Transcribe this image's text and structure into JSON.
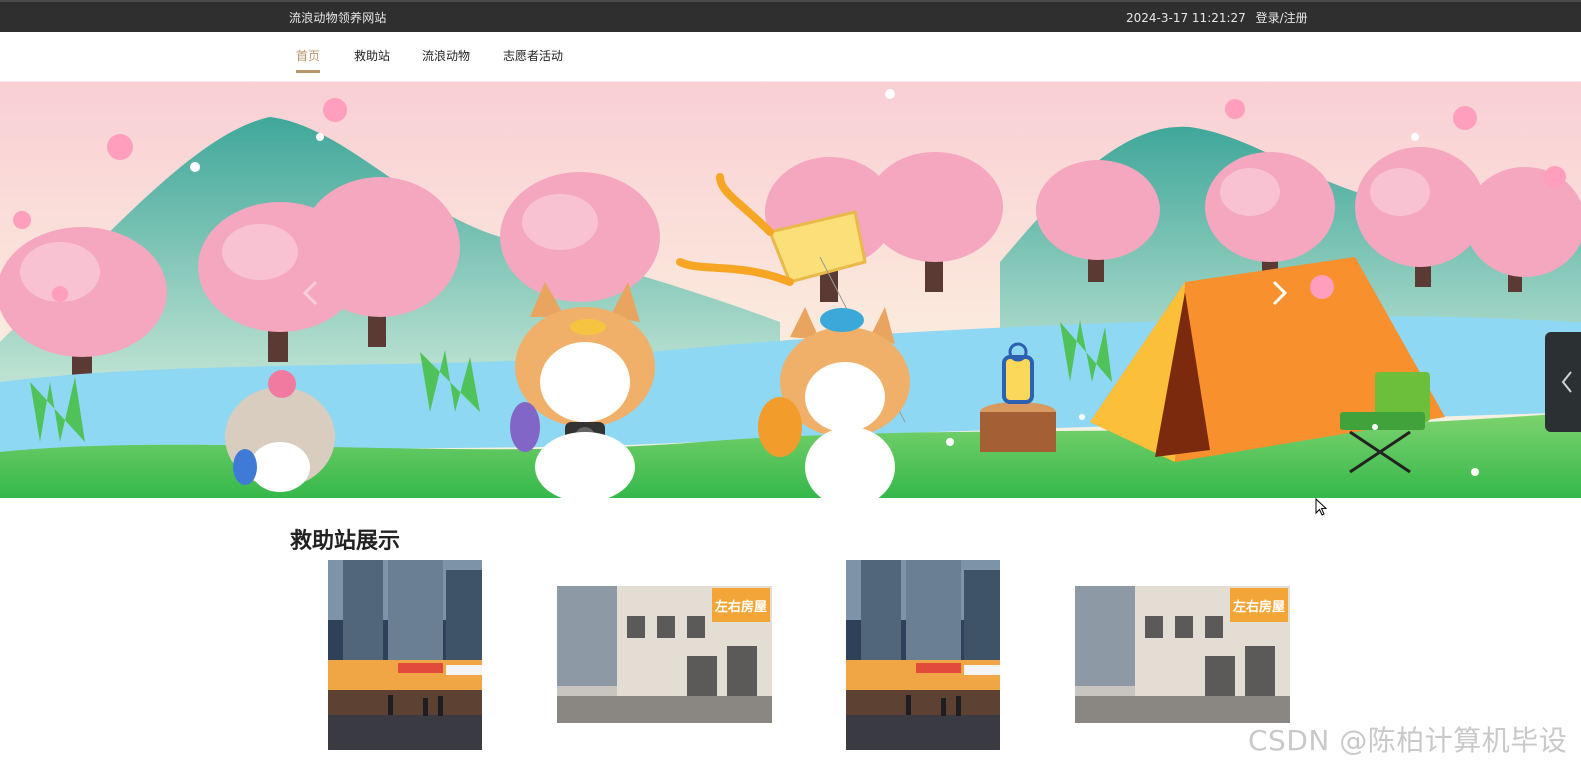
{
  "header": {
    "site_title": "流浪动物领养网站",
    "datetime": "2024-3-17 11:21:27",
    "login_label": "登录/注册"
  },
  "nav": {
    "items": [
      {
        "label": "首页",
        "active": true
      },
      {
        "label": "救助站",
        "active": false
      },
      {
        "label": "流浪动物",
        "active": false
      },
      {
        "label": "志愿者活动",
        "active": false
      }
    ]
  },
  "banner": {
    "prev_icon": "chevron-left-icon",
    "next_icon": "chevron-right-icon"
  },
  "rescue_section": {
    "title": "救助站展示",
    "cards": [
      {
        "image": "street-night-shops"
      },
      {
        "image": "street-shopfront-zuoyou-fangwu"
      },
      {
        "image": "street-night-shops"
      },
      {
        "image": "street-shopfront-zuoyou-fangwu"
      }
    ],
    "shop_sign_text": "左右房屋"
  },
  "watermark": "CSDN @陈柏计算机毕设",
  "colors": {
    "topbar": "#2f2f2f",
    "accent": "#b8956a"
  }
}
